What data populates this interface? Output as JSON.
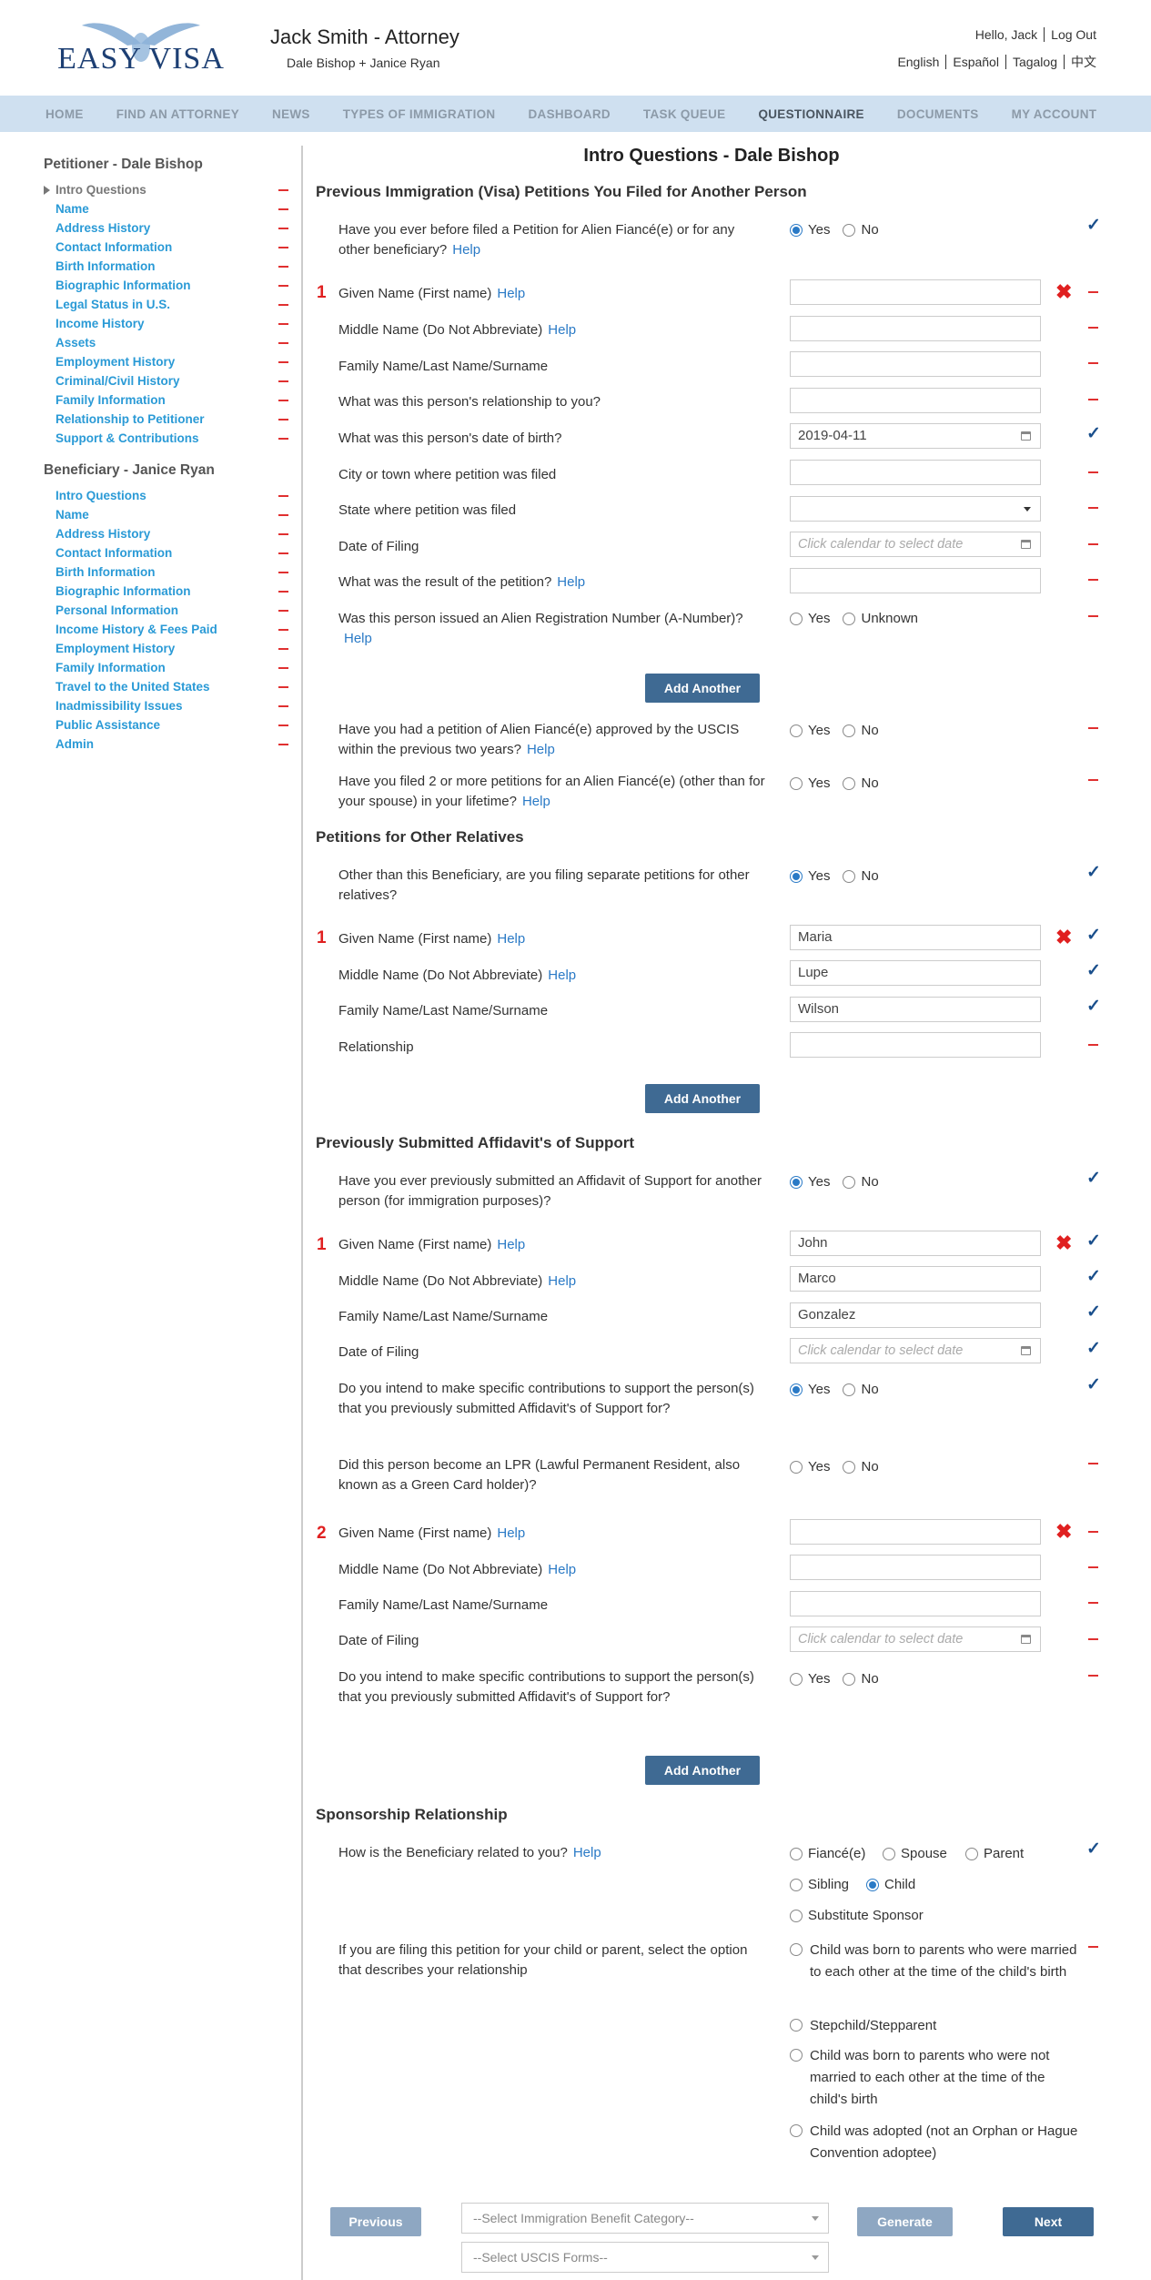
{
  "header": {
    "logo_text": "EASY VISA",
    "attorney": "Jack Smith - Attorney",
    "parties": "Dale Bishop + Janice Ryan",
    "hello": "Hello, Jack",
    "logout": "Log Out",
    "langs": [
      "English",
      "Español",
      "Tagalog",
      "中文"
    ]
  },
  "nav": [
    "HOME",
    "FIND AN ATTORNEY",
    "NEWS",
    "TYPES OF IMMIGRATION",
    "DASHBOARD",
    "TASK QUEUE",
    "QUESTIONNAIRE",
    "DOCUMENTS",
    "MY ACCOUNT"
  ],
  "nav_active": "QUESTIONNAIRE",
  "sidebar": {
    "petitioner_title": "Petitioner - Dale Bishop",
    "petitioner_items": [
      "Intro Questions",
      "Name",
      "Address History",
      "Contact Information",
      "Birth Information",
      "Biographic Information",
      "Legal Status in U.S.",
      "Income History",
      "Assets",
      "Employment History",
      "Criminal/Civil History",
      "Family Information",
      "Relationship to Petitioner",
      "Support & Contributions"
    ],
    "beneficiary_title": "Beneficiary - Janice Ryan",
    "beneficiary_items": [
      "Intro Questions",
      "Name",
      "Address History",
      "Contact Information",
      "Birth Information",
      "Biographic Information",
      "Personal Information",
      "Income History & Fees Paid",
      "Employment History",
      "Family Information",
      "Travel to the United States",
      "Inadmissibility Issues",
      "Public Assistance",
      "Admin"
    ]
  },
  "page_title": "Intro Questions - Dale Bishop",
  "help": "Help",
  "yes": "Yes",
  "no": "No",
  "unknown": "Unknown",
  "add_another": "Add Another",
  "sections": {
    "s1": "Previous Immigration (Visa) Petitions You Filed for Another Person",
    "s2": "Petitions for Other Relatives",
    "s3": "Previously Submitted Affidavit's of Support",
    "s4": "Sponsorship Relationship"
  },
  "questions": {
    "q_fiance_before": "Have you ever before filed a Petition for Alien Fiancé(e) or for any other beneficiary?",
    "given": "Given Name (First name)",
    "middle": "Middle Name (Do Not Abbreviate)",
    "family": "Family Name/Last Name/Surname",
    "relationship_you": "What was this person's relationship to you?",
    "dob": "What was this person's date of birth?",
    "city": "City or town where petition was filed",
    "state": "State where petition was filed",
    "date_filing": "Date of Filing",
    "result": "What was the result of the petition?",
    "anumber": "Was this person issued an Alien Registration Number (A-Number)?",
    "approved": "Have you had a petition of Alien Fiancé(e) approved by the USCIS within the previous two years?",
    "two_more": "Have you filed 2 or more petitions for an Alien Fiancé(e) (other than for your spouse) in your lifetime?",
    "other_relatives": "Other than this Beneficiary, are you filing separate petitions for other relatives?",
    "relationship": "Relationship",
    "affidavit_before": "Have you ever previously submitted an Affidavit of Support for another person (for immigration purposes)?",
    "contrib": "Do you intend to make specific contributions to support the person(s) that you previously submitted Affidavit's of Support for?",
    "lpr": "Did this person become an LPR (Lawful Permanent Resident, also known as a Green Card holder)?",
    "how_related": "How is the Beneficiary related to you?",
    "child_parent": "If you are filing this petition for your child or parent, select the option that describes your relationship"
  },
  "values": {
    "dob": "2019-04-11",
    "cal_placeholder": "Click calendar to select date",
    "rel_given": "Maria",
    "rel_middle": "Lupe",
    "rel_family": "Wilson",
    "aff_given": "John",
    "aff_middle": "Marco",
    "aff_family": "Gonzalez"
  },
  "numbers": [
    "1",
    "2"
  ],
  "relation_options": [
    "Fiancé(e)",
    "Spouse",
    "Parent",
    "Sibling",
    "Child",
    "Substitute Sponsor"
  ],
  "relation_selected": "Child",
  "child_options": [
    "Child was born to parents who were married to each other at the time of the child's birth",
    "Stepchild/Stepparent",
    "Child was born to parents who were not married to each other at the time of the child's birth",
    "Child was adopted (not an Orphan or Hague Convention adoptee)"
  ],
  "footer": {
    "previous": "Previous",
    "generate": "Generate",
    "next": "Next",
    "benefit_placeholder": "--Select Immigration Benefit Category--",
    "forms_placeholder": "--Select USCIS Forms--"
  },
  "colors": {
    "accent": "#2a7ac6",
    "button": "#3f6a93",
    "nav_bg": "#cfe0f0",
    "error": "#e02020",
    "check": "#1a4f8c"
  },
  "icons": {
    "valid": "check-icon",
    "remove": "close-icon",
    "pending": "dash-icon"
  }
}
